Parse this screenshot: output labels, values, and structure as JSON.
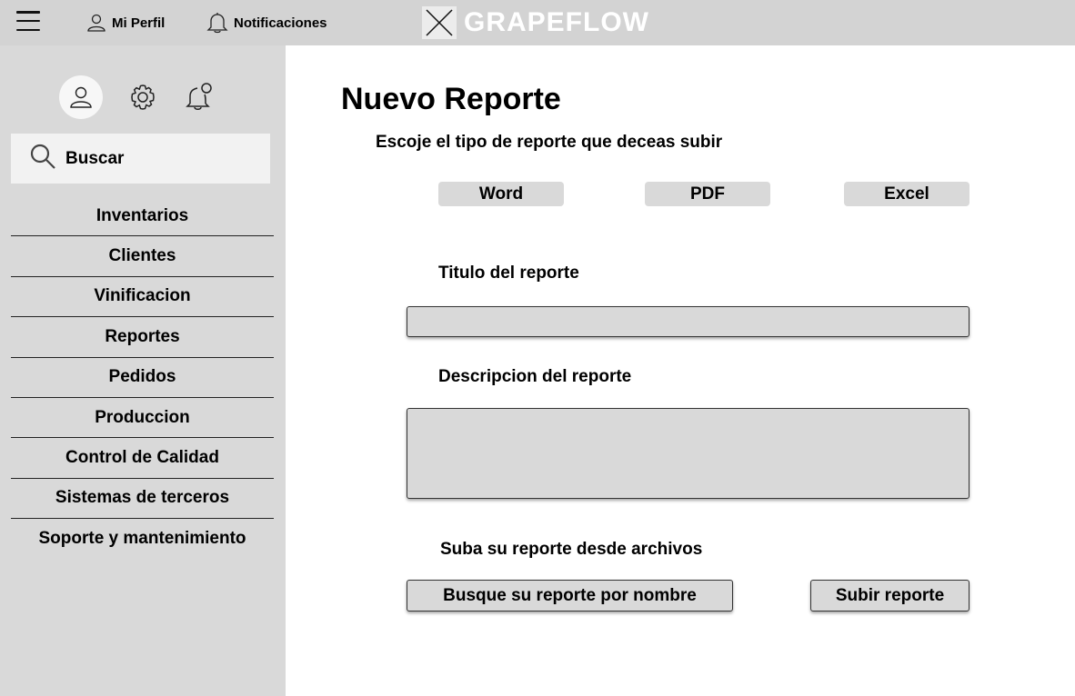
{
  "topbar": {
    "menu_icon": "hamburger-menu-icon",
    "profile_label": "Mi Perfil",
    "profile_icon": "user-icon",
    "notifications_label": "Notificaciones",
    "notifications_icon": "bell-icon",
    "logo_text": "GRAPEFLOW",
    "logo_icon": "image-placeholder-icon"
  },
  "sidebar": {
    "icons": [
      "user-icon",
      "gear-icon",
      "bell-notification-icon"
    ],
    "search_label": "Buscar",
    "search_icon": "search-icon",
    "items": [
      {
        "label": "Inventarios"
      },
      {
        "label": "Clientes"
      },
      {
        "label": "Vinificacion"
      },
      {
        "label": "Reportes"
      },
      {
        "label": "Pedidos"
      },
      {
        "label": "Produccion"
      },
      {
        "label": "Control de Calidad"
      },
      {
        "label": "Sistemas de terceros"
      },
      {
        "label": "Soporte y mantenimiento"
      }
    ]
  },
  "main": {
    "title": "Nuevo Reporte",
    "subtitle": "Escoje el tipo de reporte que deceas subir",
    "types": [
      {
        "label": "Word"
      },
      {
        "label": "PDF"
      },
      {
        "label": "Excel"
      }
    ],
    "title_field_label": "Titulo del reporte",
    "title_field_value": "",
    "description_label": "Descripcion del reporte",
    "description_value": "",
    "upload_label": "Suba su reporte desde archivos",
    "browse_button": "Busque su reporte por nombre",
    "submit_button": "Subir reporte"
  },
  "colors": {
    "topbar_bg": "#d3d3d3",
    "sidebar_bg": "#d9d9d9",
    "field_bg": "#d9d9d9",
    "search_bg": "#f2f2f2",
    "logo_text": "#ffffff"
  }
}
